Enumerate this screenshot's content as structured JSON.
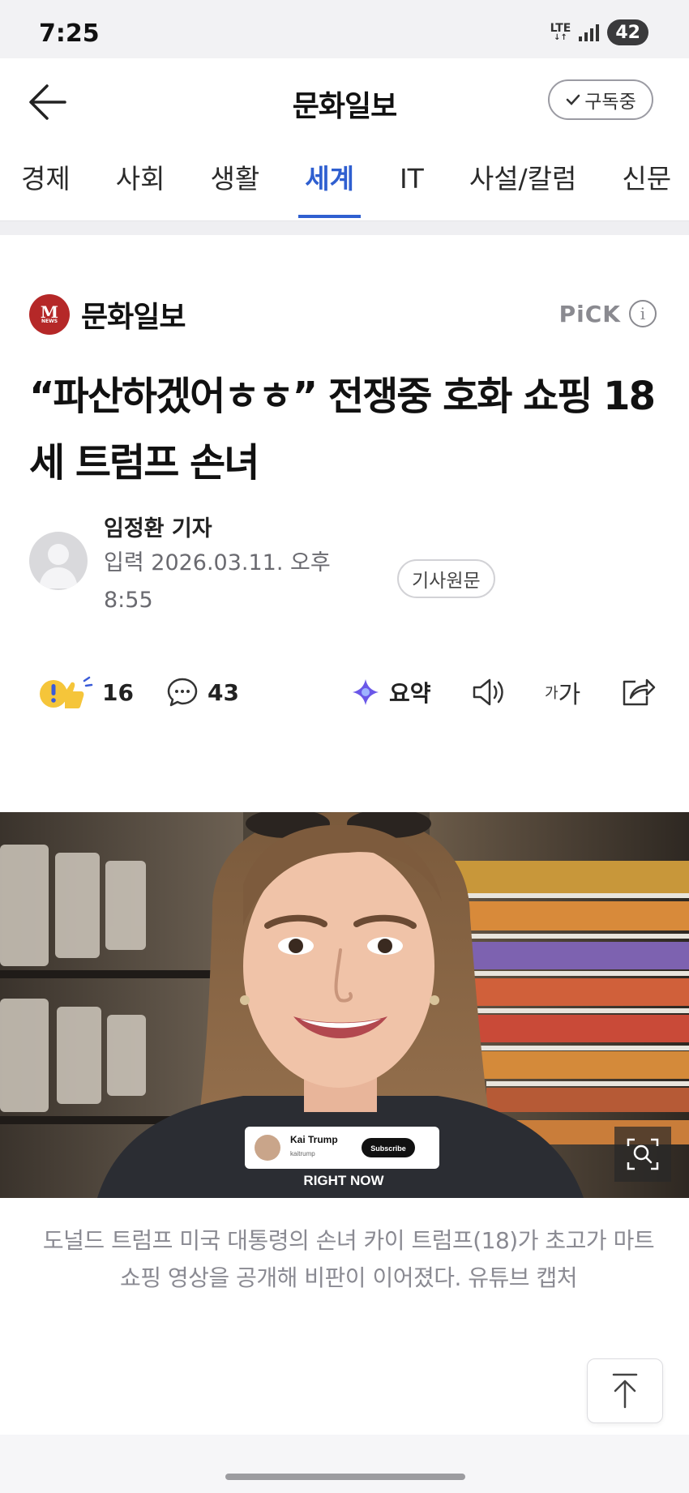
{
  "status_bar": {
    "time": "7:25",
    "network": "LTE",
    "battery": "42"
  },
  "header": {
    "title": "문화일보",
    "subscribe_label": "구독중"
  },
  "tabs": [
    {
      "label": "경제",
      "active": false
    },
    {
      "label": "사회",
      "active": false
    },
    {
      "label": "생활",
      "active": false
    },
    {
      "label": "세계",
      "active": true
    },
    {
      "label": "IT",
      "active": false
    },
    {
      "label": "사설/칼럼",
      "active": false
    },
    {
      "label": "신문",
      "active": false
    }
  ],
  "article": {
    "press_logo_letter": "M",
    "press_logo_sub": "NEWS",
    "press_name": "문화일보",
    "pick_label": "PiCK",
    "headline": "“파산하겠어ㅎㅎ” 전쟁중 호화 쇼핑 18세 트럼프 손녀",
    "reporter": "임정환 기자",
    "date": "입력 2026.03.11. 오후 8:55",
    "source_button": "기사원문",
    "reaction_count": "16",
    "comment_count": "43",
    "summary_label": "요약",
    "fontsize_small": "가",
    "fontsize_large": "가",
    "photo": {
      "card_name": "Kai Trump",
      "card_handle": "kaitrump",
      "card_subscribe": "Subscribe",
      "banner": "RIGHT NOW"
    },
    "caption": "도널드 트럼프 미국 대통령의 손녀 카이 트럼프(18)가 초고가 마트 쇼핑 영상을 공개해 비판이 이어졌다. 유튜브 캡처"
  },
  "colors": {
    "accent": "#2f5fd0",
    "press_red": "#b52828",
    "caption_gray": "#8a8a92"
  }
}
